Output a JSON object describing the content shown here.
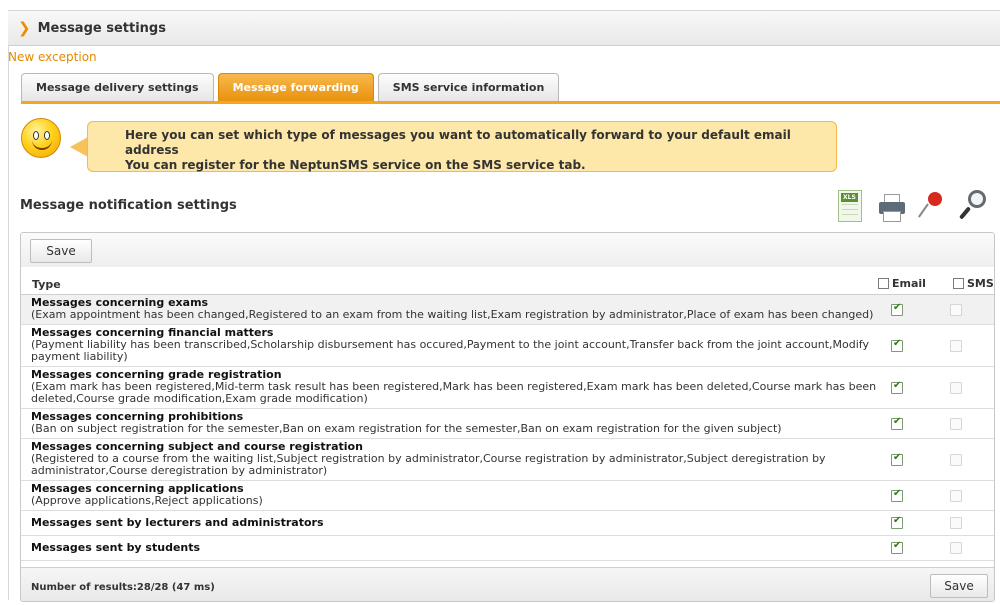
{
  "header": {
    "title": "Message settings"
  },
  "new_exception": "New exception",
  "tabs": [
    {
      "label": "Message delivery settings",
      "active": false
    },
    {
      "label": "Message forwarding",
      "active": true
    },
    {
      "label": "SMS service information",
      "active": false
    }
  ],
  "info": {
    "line1": "Here you can set which type of messages you want to automatically forward to your default email address",
    "line2": "You can register for the NeptunSMS service on the SMS service tab."
  },
  "section_title": "Message notification settings",
  "toolbar_icons": [
    "xls-export-icon",
    "print-icon",
    "pin-icon",
    "search-icon"
  ],
  "table": {
    "save_label": "Save",
    "col_type": "Type",
    "col_email": "Email",
    "col_sms": "SMS",
    "rows": [
      {
        "title": "Messages concerning exams",
        "desc": "(Exam appointment has been changed,Registered to an exam from the waiting list,Exam registration by administrator,Place of exam has been changed)",
        "email": true,
        "sms": false
      },
      {
        "title": "Messages concerning financial matters",
        "desc": "(Payment liability has been transcribed,Scholarship disbursement has occured,Payment to the joint account,Transfer back from the joint account,Modify payment liability)",
        "email": true,
        "sms": false
      },
      {
        "title": "Messages concerning grade registration",
        "desc": "(Exam mark has been registered,Mid-term task result has been registered,Mark has been registered,Exam mark has been deleted,Course mark has been deleted,Course grade modification,Exam grade modification)",
        "email": true,
        "sms": false
      },
      {
        "title": "Messages concerning prohibitions",
        "desc": "(Ban on subject registration for the semester,Ban on exam registration for the semester,Ban on exam registration for the given subject)",
        "email": true,
        "sms": false
      },
      {
        "title": "Messages concerning subject and course registration",
        "desc": "(Registered to a course from the waiting list,Subject registration by administrator,Course registration by administrator,Subject deregistration by administrator,Course deregistration by administrator)",
        "email": true,
        "sms": false
      },
      {
        "title": "Messages concerning applications",
        "desc": "(Approve applications,Reject applications)",
        "email": true,
        "sms": false
      },
      {
        "title": "Messages sent by lecturers and administrators",
        "desc": "",
        "email": true,
        "sms": false
      },
      {
        "title": "Messages sent by students",
        "desc": "",
        "email": true,
        "sms": false
      }
    ],
    "result_count": "Number of results:28/28 (47 ms)"
  },
  "colors": {
    "accent": "#f5a524",
    "link": "#e48a00",
    "bubble": "#fde7a9"
  }
}
